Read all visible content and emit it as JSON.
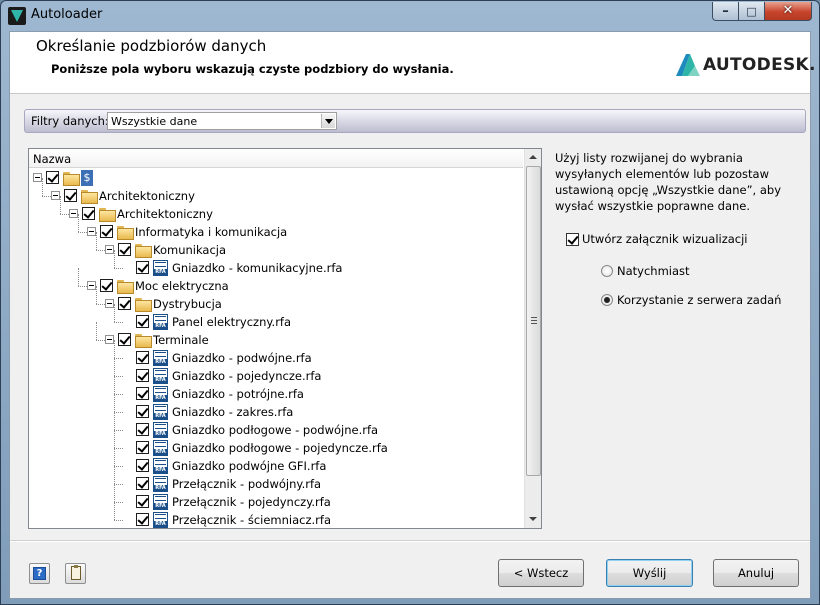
{
  "window": {
    "title": "Autoloader"
  },
  "header": {
    "title": "Określanie podzbiorów danych",
    "subtitle": "Poniższe pola wyboru wskazują czyste podzbiory do wysłania.",
    "logo_text": "AUTODESK."
  },
  "filter": {
    "label": "Filtry danych:",
    "value": "Wszystkie dane"
  },
  "tree": {
    "column_header": "Nazwa",
    "nodes": [
      {
        "label": "$",
        "kind": "root",
        "level": 0,
        "checked": true
      },
      {
        "label": "Architektoniczny",
        "kind": "folder",
        "level": 1,
        "checked": true
      },
      {
        "label": "Architektoniczny",
        "kind": "folder",
        "level": 2,
        "checked": true
      },
      {
        "label": "Informatyka i komunikacja",
        "kind": "folder",
        "level": 3,
        "checked": true
      },
      {
        "label": "Komunikacja",
        "kind": "folder",
        "level": 4,
        "checked": true
      },
      {
        "label": "Gniazdko - komunikacyjne.rfa",
        "kind": "file",
        "level": 5,
        "checked": true
      },
      {
        "label": "Moc elektryczna",
        "kind": "folder",
        "level": 3,
        "checked": true
      },
      {
        "label": "Dystrybucja",
        "kind": "folder",
        "level": 4,
        "checked": true
      },
      {
        "label": "Panel elektryczny.rfa",
        "kind": "file",
        "level": 5,
        "checked": true
      },
      {
        "label": "Terminale",
        "kind": "folder",
        "level": 4,
        "checked": true
      },
      {
        "label": "Gniazdko - podwójne.rfa",
        "kind": "file",
        "level": 5,
        "checked": true
      },
      {
        "label": "Gniazdko - pojedyncze.rfa",
        "kind": "file",
        "level": 5,
        "checked": true
      },
      {
        "label": "Gniazdko - potrójne.rfa",
        "kind": "file",
        "level": 5,
        "checked": true
      },
      {
        "label": "Gniazdko - zakres.rfa",
        "kind": "file",
        "level": 5,
        "checked": true
      },
      {
        "label": "Gniazdko podłogowe - podwójne.rfa",
        "kind": "file",
        "level": 5,
        "checked": true
      },
      {
        "label": "Gniazdko podłogowe - pojedyncze.rfa",
        "kind": "file",
        "level": 5,
        "checked": true
      },
      {
        "label": "Gniazdko podwójne GFI.rfa",
        "kind": "file",
        "level": 5,
        "checked": true
      },
      {
        "label": "Przełącznik - podwójny.rfa",
        "kind": "file",
        "level": 5,
        "checked": true
      },
      {
        "label": "Przełącznik - pojedynczy.rfa",
        "kind": "file",
        "level": 5,
        "checked": true
      },
      {
        "label": "Przełącznik - ściemniacz.rfa",
        "kind": "file",
        "level": 5,
        "checked": true
      }
    ]
  },
  "options": {
    "help_text": "Użyj listy rozwijanej do wybrania wysyłanych elementów lub pozostaw ustawioną opcję „Wszystkie dane”, aby wysłać wszystkie poprawne dane.",
    "viz_label": "Utwórz załącznik wizualizacji",
    "viz_checked": true,
    "radio_now": "Natychmiast",
    "radio_server": "Korzystanie z serwera zadań",
    "selected": "server"
  },
  "buttons": {
    "back": "< Wstecz",
    "send": "Wyślij",
    "cancel": "Anuluj"
  },
  "colors": {
    "autodesk_teal": "#2fb5a8",
    "titlebar": "#9fb8d1"
  }
}
